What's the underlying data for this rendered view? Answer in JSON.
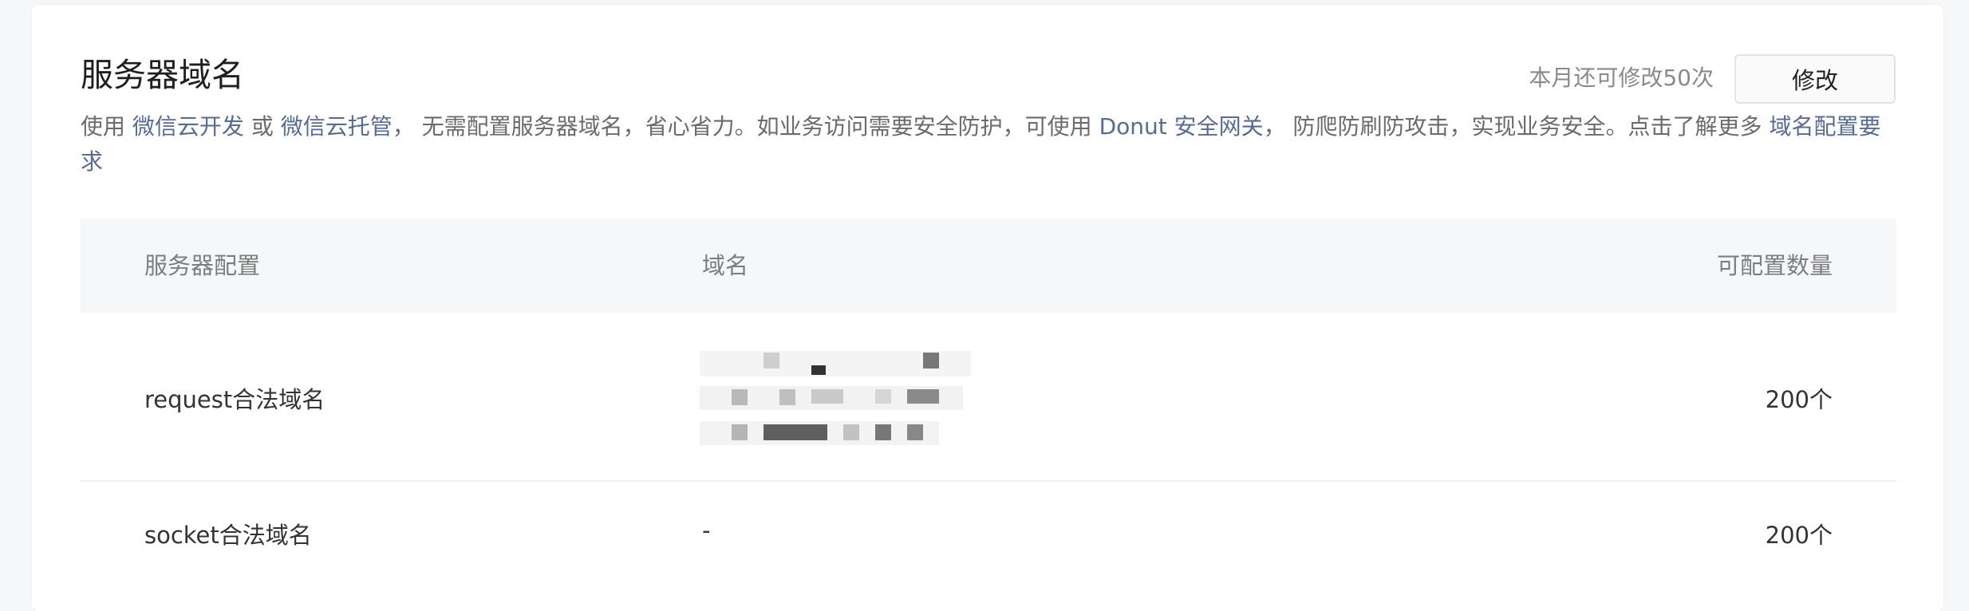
{
  "header": {
    "title": "服务器域名",
    "quota_text": "本月还可修改50次",
    "edit_label": "修改"
  },
  "description": {
    "part1": "使用 ",
    "link1": "微信云开发",
    "part2": " 或 ",
    "link2": "微信云托管",
    "part3": "， 无需配置服务器域名，省心省力。如业务访问需要安全防护，可使用 ",
    "link3": "Donut 安全网关",
    "part4": "， 防爬防刷防攻击，实现业务安全。点击了解更多 ",
    "link4": "域名配置要求"
  },
  "table": {
    "headers": [
      "服务器配置",
      "域名",
      "可配置数量"
    ],
    "rows": [
      {
        "config": "request合法域名",
        "domain": "",
        "count": "200个"
      },
      {
        "config": "socket合法域名",
        "domain": "-",
        "count": "200个"
      }
    ]
  },
  "colors": {
    "link": "#576b95",
    "muted": "#8a8a8a",
    "header_bg": "#f6f7f9"
  }
}
